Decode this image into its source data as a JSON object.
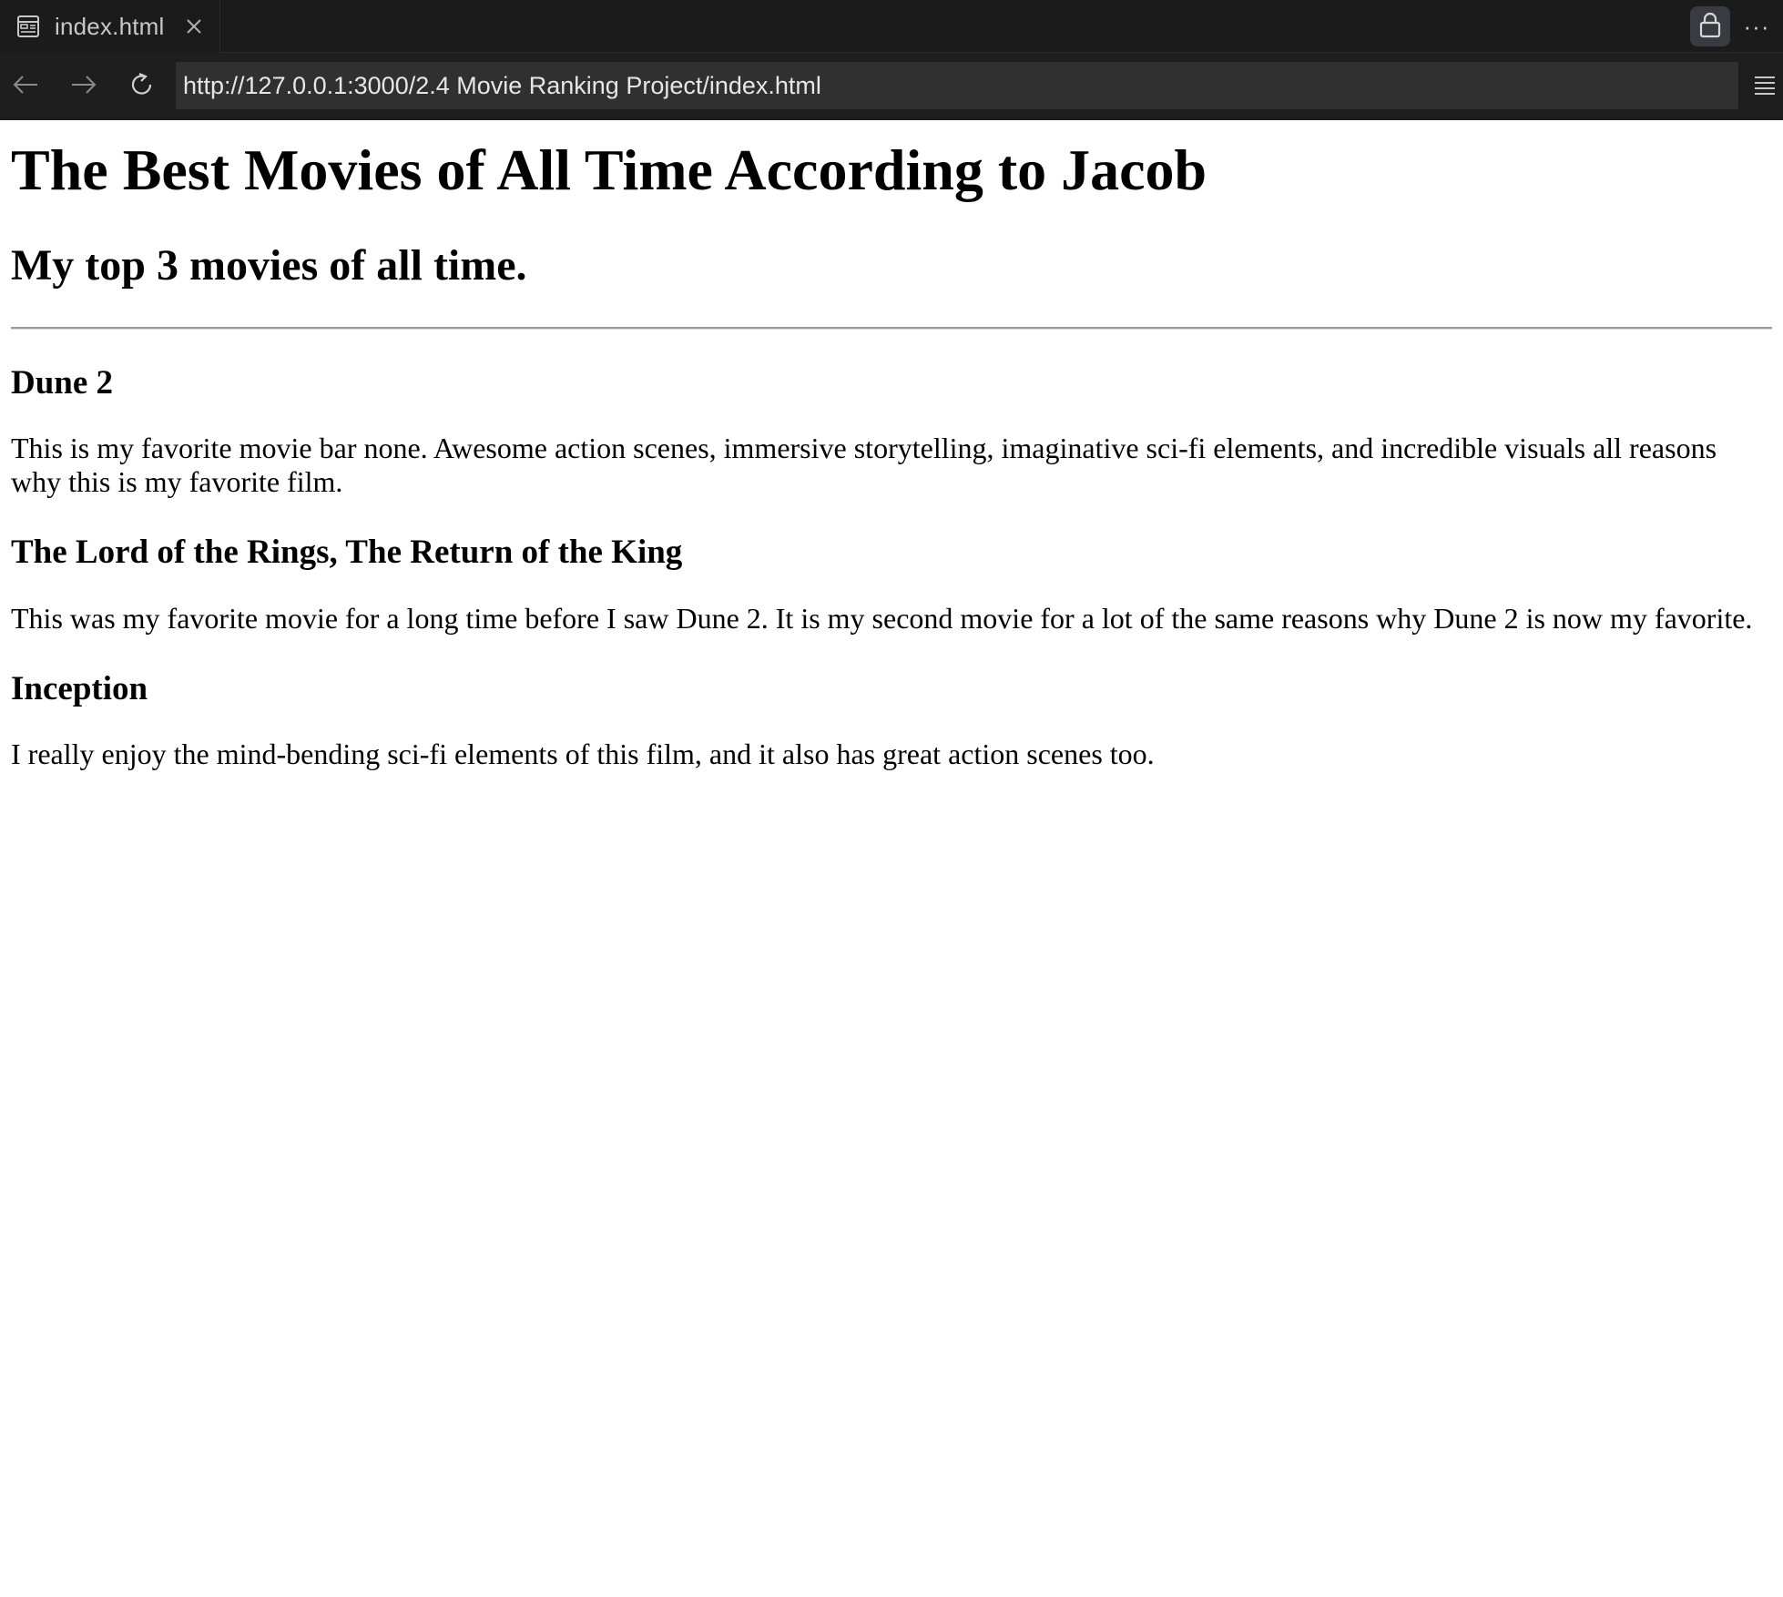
{
  "browser": {
    "tab": {
      "title": "index.html",
      "icon": "preview-icon",
      "close_icon": "close-icon"
    },
    "toolbar": {
      "lock_icon": "lock-icon",
      "more_icon": "more-icon",
      "more_label": "···"
    },
    "nav": {
      "back_icon": "arrow-left-icon",
      "forward_icon": "arrow-right-icon",
      "reload_icon": "reload-icon",
      "url": "http://127.0.0.1:3000/2.4 Movie Ranking Project/index.html",
      "menu_icon": "hamburger-icon"
    }
  },
  "page": {
    "title": "The Best Movies of All Time According to Jacob",
    "subtitle": "My top 3 movies of all time.",
    "movies": [
      {
        "name": "Dune 2",
        "description": "This is my favorite movie bar none. Awesome action scenes, immersive storytelling, imaginative sci-fi elements, and incredible visuals all reasons why this is my favorite film."
      },
      {
        "name": "The Lord of the Rings, The Return of the King",
        "description": "This was my favorite movie for a long time before I saw Dune 2. It is my second movie for a lot of the same reasons why Dune 2 is now my favorite."
      },
      {
        "name": "Inception",
        "description": "I really enjoy the mind-bending sci-fi elements of this film, and it also has great action scenes too."
      }
    ]
  },
  "colors": {
    "chrome_bg": "#1b1b1c",
    "urlbar_bg": "#303031",
    "lock_button_bg": "#3a3a42",
    "page_bg": "#ffffff",
    "text": "#000000"
  }
}
